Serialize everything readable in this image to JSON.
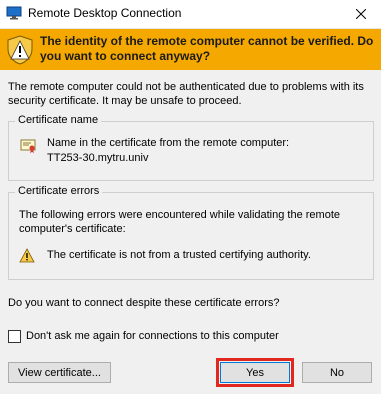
{
  "window": {
    "title": "Remote Desktop Connection",
    "app_icon": "remote-desktop-icon",
    "close_icon": "close-icon"
  },
  "banner": {
    "icon": "warning-shield-icon",
    "text": "The identity of the remote computer cannot be verified. Do you want to connect anyway?",
    "color": "#f5a800"
  },
  "intro": "The remote computer could not be authenticated due to problems with its security certificate. It may be unsafe to proceed.",
  "certificate_name": {
    "title": "Certificate name",
    "icon": "certificate-icon",
    "label": "Name in the certificate from the remote computer:",
    "value": "TT253-30.mytru.univ"
  },
  "certificate_errors": {
    "title": "Certificate errors",
    "description": "The following errors were encountered while validating the remote computer's certificate:",
    "icon": "warning-icon",
    "errors": [
      "The certificate is not from a trusted certifying authority."
    ]
  },
  "question": "Do you want to connect despite these certificate errors?",
  "dont_ask": {
    "label": "Don't ask me again for connections to this computer",
    "checked": false
  },
  "buttons": {
    "view_certificate": "View certificate...",
    "yes": "Yes",
    "no": "No"
  },
  "highlight_color": "#e0281e"
}
